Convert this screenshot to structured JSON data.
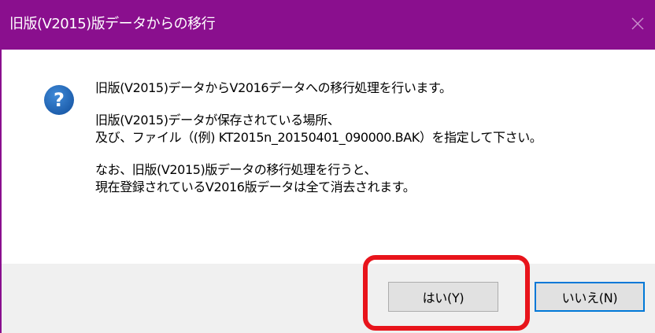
{
  "window": {
    "title": "旧版(V2015)版データからの移行",
    "close_glyph": "✕"
  },
  "colors": {
    "titlebar": "#8a0f8e",
    "icon_blue": "#1f64b4",
    "focus_border": "#0078d7",
    "highlight_red": "#e8141b"
  },
  "icon": {
    "name": "question-icon",
    "glyph": "?"
  },
  "message": {
    "line1": "旧版(V2015)データからV2016データへの移行処理を行います。",
    "line2": "旧版(V2015)データが保存されている場所、",
    "line3": "及び、ファイル（(例) KT2015n_20150401_090000.BAK）を指定して下さい。",
    "line4": "なお、旧版(V2015)版データの移行処理を行うと、",
    "line5": "現在登録されているV2016版データは全て消去されます。"
  },
  "buttons": {
    "yes_label": "はい(Y)",
    "no_label": "いいえ(N)"
  }
}
